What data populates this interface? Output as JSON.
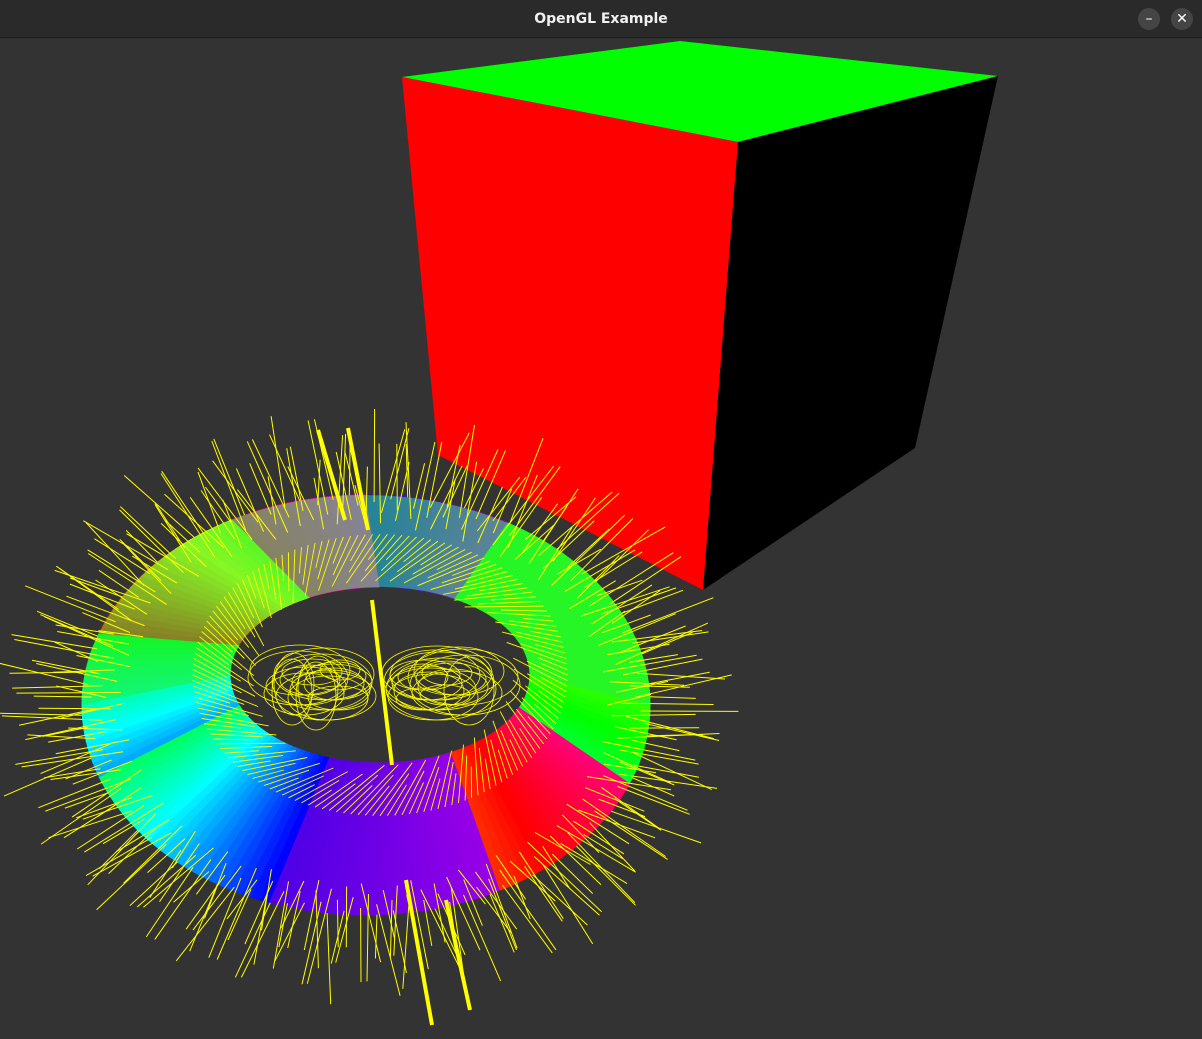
{
  "window": {
    "title": "OpenGL Example",
    "minimize_glyph": "–",
    "close_glyph": "✕"
  },
  "scene": {
    "background_color": "#333333",
    "cube": {
      "top_color": "#00ff00",
      "front_color": "#ff0000",
      "side_color": "#000000"
    },
    "torus": {
      "color_stops": [
        "#ff0000",
        "#00ff00",
        "#0000ff",
        "#8000ff"
      ],
      "normals_color": "#ffff00"
    }
  }
}
